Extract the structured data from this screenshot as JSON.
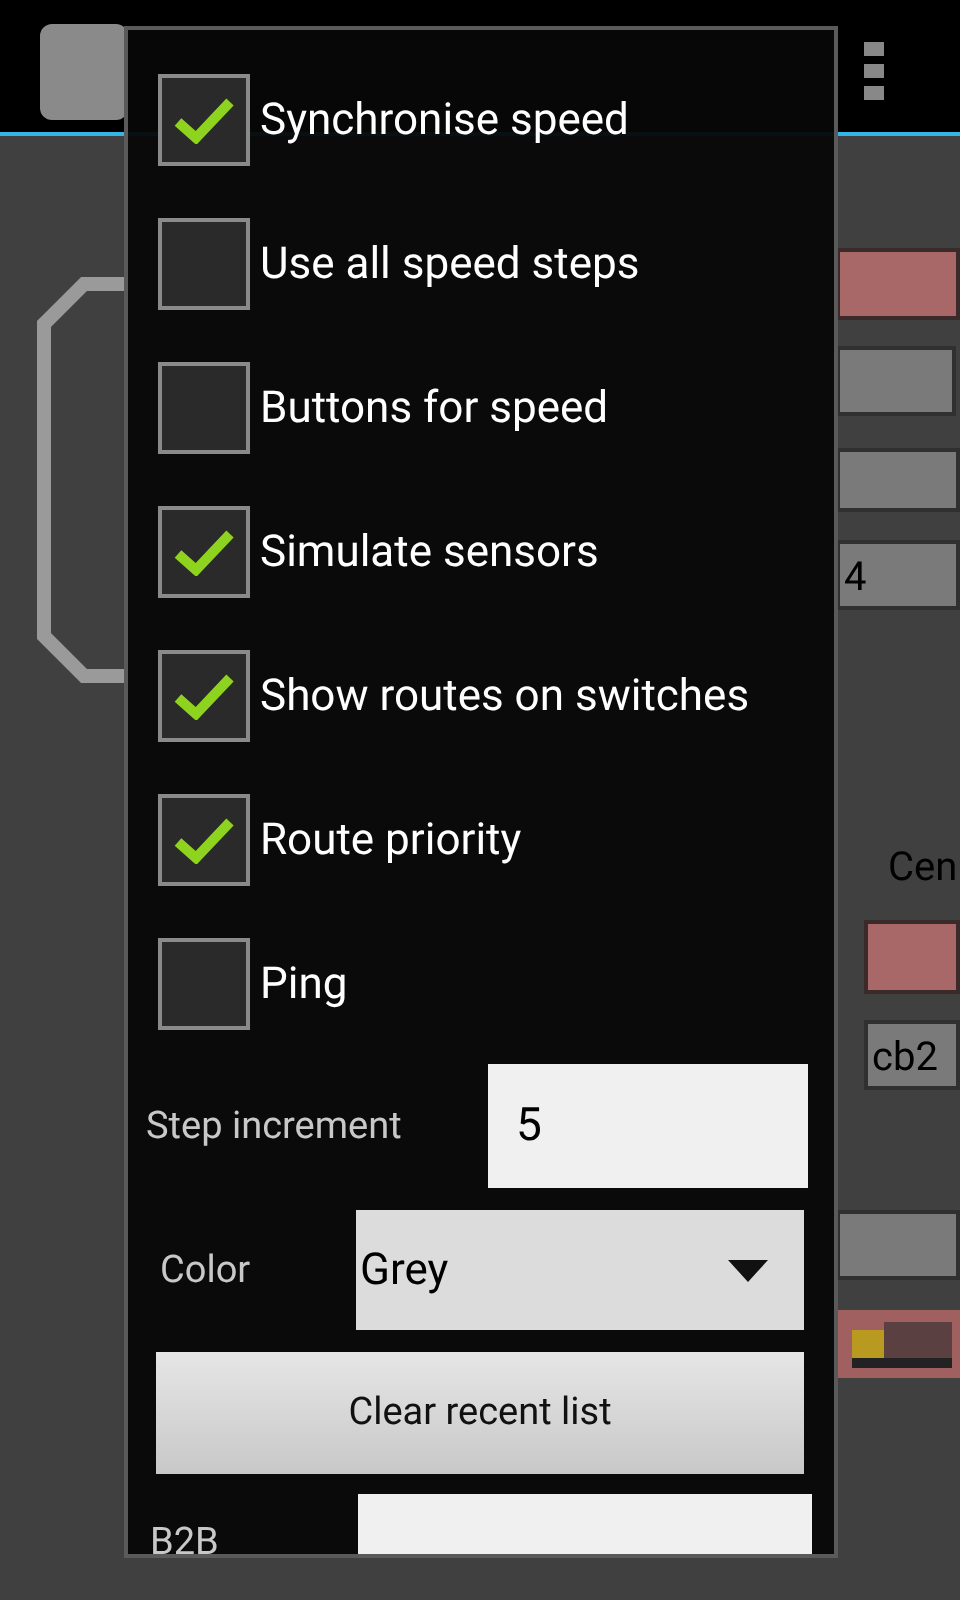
{
  "plan": {
    "blocks": [
      {
        "kind": "red"
      },
      {
        "kind": "grey"
      },
      {
        "kind": "grey"
      },
      {
        "kind": "grey",
        "label": "4"
      },
      {
        "kind": "text",
        "label": "Cen"
      },
      {
        "kind": "red"
      },
      {
        "kind": "grey",
        "label": "cb2"
      },
      {
        "kind": "grey"
      },
      {
        "kind": "loco"
      }
    ]
  },
  "dialog": {
    "options": [
      {
        "label": "Synchronise speed",
        "checked": true
      },
      {
        "label": "Use all speed steps",
        "checked": false
      },
      {
        "label": "Buttons for speed",
        "checked": false
      },
      {
        "label": "Simulate sensors",
        "checked": true
      },
      {
        "label": "Show routes on switches",
        "checked": true
      },
      {
        "label": "Route priority",
        "checked": true
      },
      {
        "label": "Ping",
        "checked": false
      }
    ],
    "step_increment": {
      "label": "Step increment",
      "value": "5"
    },
    "color": {
      "label": "Color",
      "value": "Grey"
    },
    "clear_button": "Clear recent list",
    "b2b": {
      "label": "B2B"
    }
  }
}
